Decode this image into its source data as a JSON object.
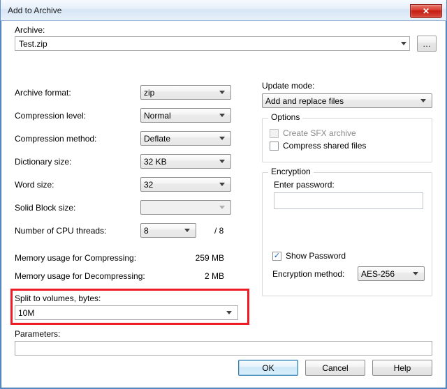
{
  "window": {
    "title": "Add to Archive"
  },
  "archive": {
    "label": "Archive:",
    "value": "Test.zip"
  },
  "left": {
    "format_label": "Archive format:",
    "format_value": "zip",
    "level_label": "Compression level:",
    "level_value": "Normal",
    "method_label": "Compression method:",
    "method_value": "Deflate",
    "dict_label": "Dictionary size:",
    "dict_value": "32 KB",
    "word_label": "Word size:",
    "word_value": "32",
    "solid_label": "Solid Block size:",
    "solid_value": "",
    "threads_label": "Number of CPU threads:",
    "threads_value": "8",
    "threads_total": "/ 8",
    "mem_comp_label": "Memory usage for Compressing:",
    "mem_comp_value": "259 MB",
    "mem_decomp_label": "Memory usage for Decompressing:",
    "mem_decomp_value": "2 MB",
    "split_label": "Split to volumes, bytes:",
    "split_value": "10M",
    "params_label": "Parameters:"
  },
  "right": {
    "update_label": "Update mode:",
    "update_value": "Add and replace files",
    "options_legend": "Options",
    "opt_sfx": "Create SFX archive",
    "opt_compress_shared": "Compress shared files",
    "enc_legend": "Encryption",
    "enc_pw_label": "Enter password:",
    "enc_show_pw": "Show Password",
    "enc_method_label": "Encryption method:",
    "enc_method_value": "AES-256"
  },
  "buttons": {
    "ok": "OK",
    "cancel": "Cancel",
    "help": "Help"
  }
}
